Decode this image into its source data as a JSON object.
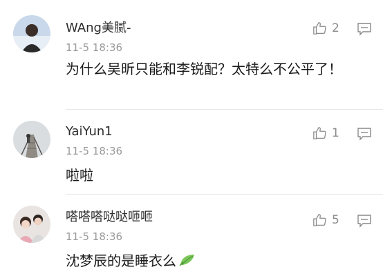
{
  "comments": [
    {
      "username": "WAng美腻-",
      "time": "11-5 18:36",
      "text": "为什么吴昕只能和李锐配？太特么不公平了！",
      "likes": "2",
      "icons": {
        "like": "thumbs-up-icon",
        "reply": "reply-comment-icon"
      }
    },
    {
      "username": "YaiYun1",
      "time": "11-5 18:36",
      "text": "啦啦",
      "likes": "1",
      "icons": {
        "like": "thumbs-up-icon",
        "reply": "reply-comment-icon"
      }
    },
    {
      "username": "嗒嗒嗒哒哒咂咂",
      "time": "11-5 18:36",
      "text": "沈梦辰的是睡衣么",
      "likes": "5",
      "icons": {
        "like": "thumbs-up-icon",
        "reply": "reply-comment-icon",
        "emoji": "leaf-emoji-icon"
      }
    }
  ],
  "colors": {
    "text": "#1a1a1a",
    "muted": "#9a9a9a",
    "divider": "#e6e6e6",
    "leaf": "#6fbf4a"
  }
}
